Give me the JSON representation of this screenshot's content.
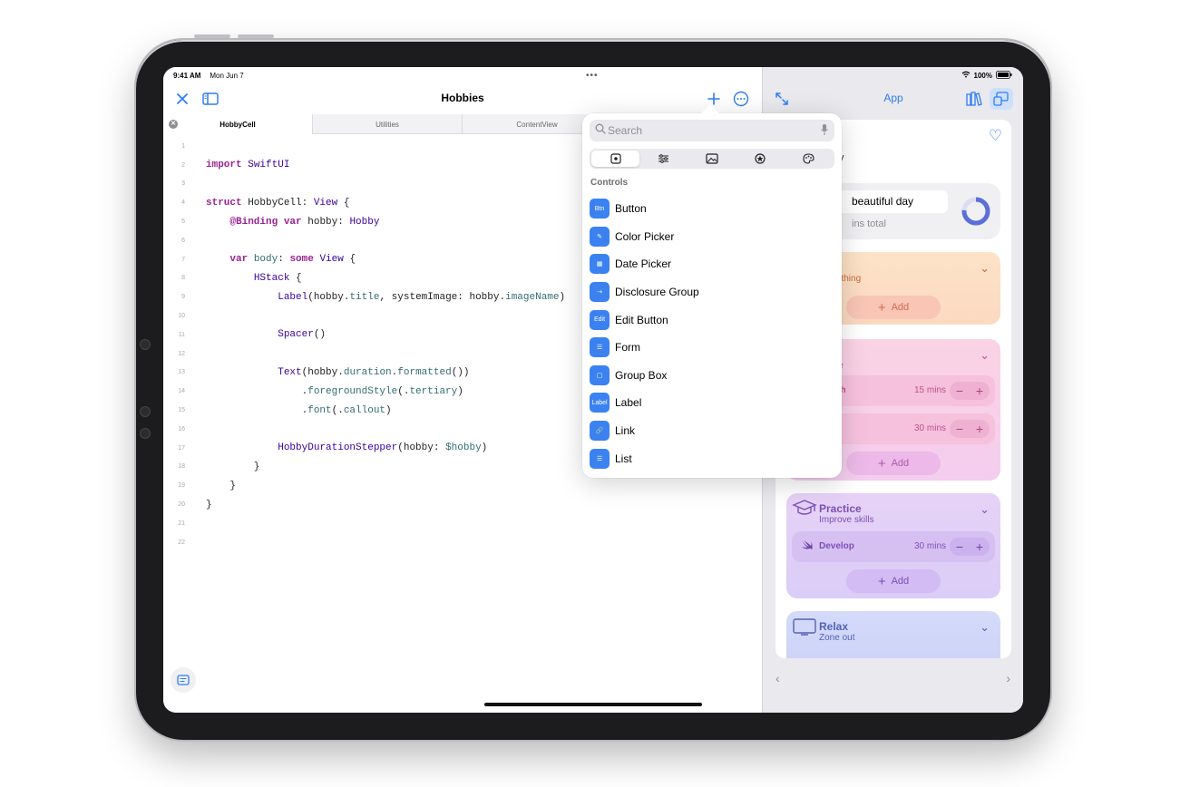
{
  "status": {
    "time": "9:41 AM",
    "date": "Mon Jun 7",
    "battery": "100%"
  },
  "editor": {
    "title": "Hobbies",
    "tabs": [
      {
        "label": "HobbyCell"
      },
      {
        "label": "Utilities"
      },
      {
        "label": "ContentView"
      },
      {
        "label": ""
      }
    ],
    "code": [
      {
        "n": "1",
        "t": ""
      },
      {
        "n": "2",
        "t": "import SwiftUI"
      },
      {
        "n": "3",
        "t": ""
      },
      {
        "n": "4",
        "t": "struct HobbyCell: View {"
      },
      {
        "n": "5",
        "t": "    @Binding var hobby: Hobby"
      },
      {
        "n": "6",
        "t": ""
      },
      {
        "n": "7",
        "t": "    var body: some View {"
      },
      {
        "n": "8",
        "t": "        HStack {"
      },
      {
        "n": "9",
        "t": "            Label(hobby.title, systemImage: hobby.imageName)"
      },
      {
        "n": "10",
        "t": ""
      },
      {
        "n": "11",
        "t": "            Spacer()"
      },
      {
        "n": "12",
        "t": ""
      },
      {
        "n": "13",
        "t": "            Text(hobby.duration.formatted())"
      },
      {
        "n": "14",
        "t": "                .foregroundStyle(.tertiary)"
      },
      {
        "n": "15",
        "t": "                .font(.callout)"
      },
      {
        "n": "16",
        "t": ""
      },
      {
        "n": "17",
        "t": "            HobbyDurationStepper(hobby: $hobby)"
      },
      {
        "n": "18",
        "t": "        }"
      },
      {
        "n": "19",
        "t": "    }"
      },
      {
        "n": "20",
        "t": "}"
      },
      {
        "n": "21",
        "t": ""
      },
      {
        "n": "22",
        "t": ""
      }
    ]
  },
  "library": {
    "search_placeholder": "Search",
    "section": "Controls",
    "items": [
      {
        "label": "Button",
        "glyph": "Btn"
      },
      {
        "label": "Color Picker",
        "glyph": "✎"
      },
      {
        "label": "Date Picker",
        "glyph": "▦"
      },
      {
        "label": "Disclosure Group",
        "glyph": "⇢"
      },
      {
        "label": "Edit Button",
        "glyph": "Edit"
      },
      {
        "label": "Form",
        "glyph": "☰"
      },
      {
        "label": "Group Box",
        "glyph": "▢"
      },
      {
        "label": "Label",
        "glyph": "Label"
      },
      {
        "label": "Link",
        "glyph": "🔗"
      },
      {
        "label": "List",
        "glyph": "☰"
      },
      {
        "label": "",
        "glyph": ""
      }
    ]
  },
  "preview": {
    "title": "App",
    "day_label": "y",
    "summary_title": "beautiful day",
    "summary_sub": "ins total",
    "cards": {
      "create": {
        "title": "te",
        "sub": "something",
        "add": "Add"
      },
      "explore": {
        "title": "e",
        "sub": "utside",
        "rows": [
          {
            "name": "Watch",
            "mins": "15 mins"
          },
          {
            "name": "",
            "mins": "30 mins"
          }
        ],
        "add": "Add"
      },
      "practice": {
        "title": "Practice",
        "sub": "Improve skills",
        "rows": [
          {
            "name": "Develop",
            "mins": "30 mins"
          }
        ],
        "add": "Add"
      },
      "relax": {
        "title": "Relax",
        "sub": "Zone out"
      }
    }
  },
  "colors": {
    "accent": "#2f7cf6",
    "library_icon": "#3b82f0"
  }
}
